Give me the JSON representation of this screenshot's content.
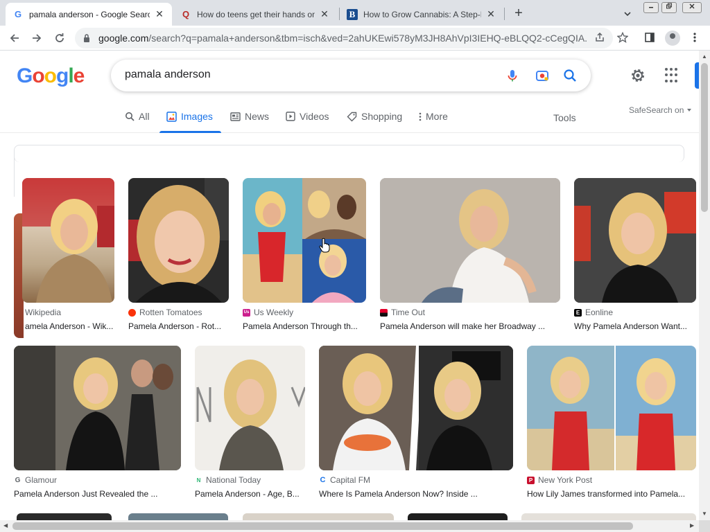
{
  "browser": {
    "tabs": [
      {
        "title": "pamala anderson - Google Searc",
        "favicon": "G",
        "favicon_color": "#4285f4",
        "active": true
      },
      {
        "title": "How do teens get their hands on",
        "favicon": "Q",
        "favicon_color": "#b92b27",
        "active": false
      },
      {
        "title": "How to Grow Cannabis: A Step-B",
        "favicon": "B",
        "favicon_color": "#1a4d8f",
        "active": false
      }
    ],
    "new_tab_icon": "+",
    "tab_menu_icon": "chevron-down-icon",
    "window_controls": [
      "minimize",
      "restore",
      "close"
    ],
    "url_host": "google.com",
    "url_rest": "/search?q=pamala+anderson&tbm=isch&ved=2ahUKEwi578yM3JH8AhVpI3IEHQ-eBLQQ2-cCegQIA..."
  },
  "google": {
    "logo_letters": [
      "G",
      "o",
      "o",
      "g",
      "l",
      "e"
    ],
    "query": "pamala anderson",
    "tabs": [
      {
        "label": "All",
        "icon": "search-icon"
      },
      {
        "label": "Images",
        "icon": "image-icon"
      },
      {
        "label": "News",
        "icon": "news-icon"
      },
      {
        "label": "Videos",
        "icon": "video-icon"
      },
      {
        "label": "Shopping",
        "icon": "tag-icon"
      },
      {
        "label": "More",
        "icon": "more-vert-icon"
      }
    ],
    "tools_label": "Tools",
    "safesearch_label": "SafeSearch on"
  },
  "results": [
    {
      "source": "Wikipedia",
      "caption": "amela Anderson - Wik...",
      "favicon_color": "#000000",
      "favicon_text": "W"
    },
    {
      "source": "Rotten Tomatoes",
      "caption": "Pamela Anderson - Rot...",
      "favicon_color": "#fa320a",
      "favicon_text": ""
    },
    {
      "source": "Us Weekly",
      "caption": "Pamela Anderson Through th...",
      "favicon_color": "#cc1f8e",
      "favicon_text": "Us"
    },
    {
      "source": "Time Out",
      "caption": "Pamela Anderson will make her Broadway ...",
      "favicon_color": "#e4002b",
      "favicon_text": ""
    },
    {
      "source": "Eonline",
      "caption": "Why Pamela Anderson Want...",
      "favicon_color": "#000000",
      "favicon_text": "E"
    },
    {
      "source": "Glamour",
      "caption": "Pamela Anderson Just Revealed the ...",
      "favicon_color": "#5f6368",
      "favicon_text": "G"
    },
    {
      "source": "National Today",
      "caption": "Pamela Anderson - Age, B...",
      "favicon_color": "#2bb673",
      "favicon_text": "N"
    },
    {
      "source": "Capital FM",
      "caption": "Where Is Pamela Anderson Now? Inside ...",
      "favicon_color": "#1a73e8",
      "favicon_text": "C"
    },
    {
      "source": "New York Post",
      "caption": "How Lily James transformed into Pamela...",
      "favicon_color": "#c8102e",
      "favicon_text": "P"
    }
  ],
  "colors": {
    "accent": "#1a73e8",
    "tabstrip_bg": "#dee1e6"
  }
}
